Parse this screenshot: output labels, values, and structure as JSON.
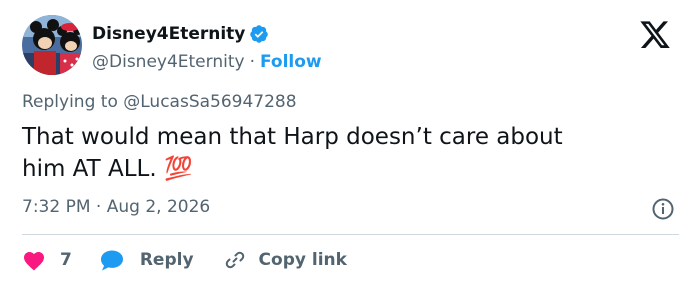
{
  "author": {
    "name": "Disney4Eternity",
    "handle": "@Disney4Eternity",
    "separator": "·",
    "follow_label": "Follow"
  },
  "reply_to": {
    "prefix": "Replying to",
    "handle": "@LucasSa56947288"
  },
  "tweet": {
    "text_line1": "That would mean that Harp doesn’t care about",
    "text_line2": "him AT ALL.",
    "emoji": "💯"
  },
  "meta": {
    "time": "7:32 PM",
    "separator": "·",
    "date": "Aug 2, 2026"
  },
  "actions": {
    "like_count": "7",
    "reply_label": "Reply",
    "copy_label": "Copy link"
  },
  "colors": {
    "accent": "#1d9bf0",
    "like": "#f91880",
    "secondary_text": "#536471",
    "divider": "#cfd9de"
  },
  "icons": {
    "verified": "verified-badge-icon",
    "logo": "x-logo-icon",
    "info": "info-icon",
    "like": "heart-icon",
    "reply": "speech-bubble-icon",
    "copy": "link-icon"
  }
}
